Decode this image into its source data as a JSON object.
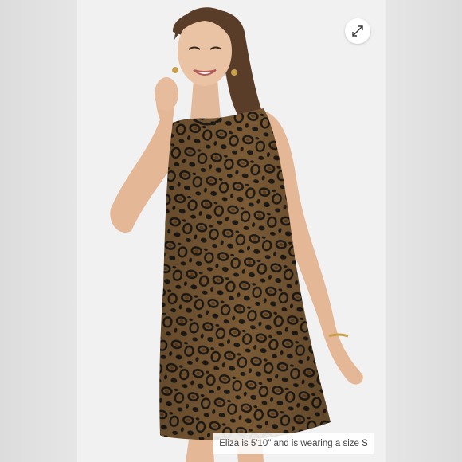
{
  "viewer": {
    "expand_icon": "expand-arrows-icon",
    "caption": "Eliza is 5'10\" and is wearing a size S"
  },
  "colors": {
    "background": "#eaeaea",
    "photo_background": "#f1f1f1",
    "dress_base": "#7a5a35",
    "leopard_spot": "#1e1a16"
  }
}
